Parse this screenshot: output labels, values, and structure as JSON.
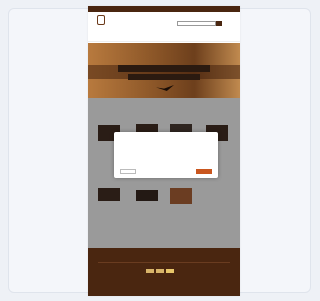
{
  "page": {
    "topbar_links": [
      "",
      "",
      ""
    ],
    "brand": "",
    "logo_mark": "",
    "search_placeholder": "",
    "cart_label": "",
    "nav": [
      "",
      "",
      "",
      "",
      ""
    ],
    "hero": {
      "title": "",
      "subtitle": ""
    },
    "section_title": "",
    "products": [
      {
        "name": ""
      },
      {
        "name": ""
      },
      {
        "name": ""
      },
      {
        "name": ""
      },
      {
        "name": ""
      },
      {
        "name": ""
      },
      {
        "name": ""
      }
    ],
    "cookie_modal": {
      "title": "",
      "text": "",
      "link": "",
      "dismiss": "",
      "accept": ""
    },
    "footer": {
      "links": [
        "",
        "",
        "",
        "",
        "",
        ""
      ],
      "copyright": ""
    }
  },
  "colors": {
    "brand_brown": "#4a2610",
    "accent_orange": "#c9561e",
    "overlay_grey": "#9a9a9a",
    "background": "#eef1f6"
  },
  "icons": [
    "logo-icon",
    "search-icon",
    "cart-icon",
    "payment-icon"
  ]
}
